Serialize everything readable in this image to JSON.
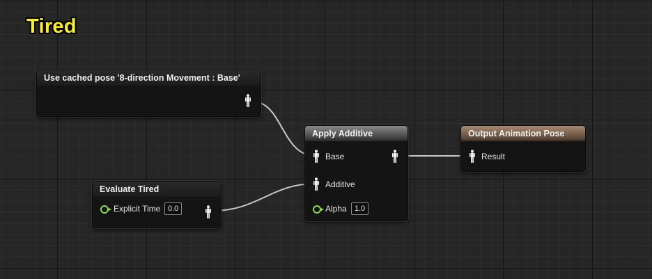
{
  "comment": {
    "title": "Tired"
  },
  "nodes": {
    "cached_pose": {
      "title": "Use cached pose '8-direction Movement : Base'"
    },
    "evaluate_tired": {
      "title": "Evaluate Tired",
      "explicit_time_label": "Explicit Time",
      "explicit_time_value": "0.0"
    },
    "apply_additive": {
      "title": "Apply Additive",
      "base_label": "Base",
      "additive_label": "Additive",
      "alpha_label": "Alpha",
      "alpha_value": "1.0"
    },
    "output_pose": {
      "title": "Output Animation Pose",
      "result_label": "Result"
    }
  },
  "colors": {
    "comment_text": "#ffef1a",
    "float_pin": "#8ce04a",
    "wire": "#c8c8c8",
    "output_header": "#a88a72"
  },
  "icons": {
    "pose_pin": "pose-figure-icon",
    "float_pin": "float-pin-icon"
  }
}
